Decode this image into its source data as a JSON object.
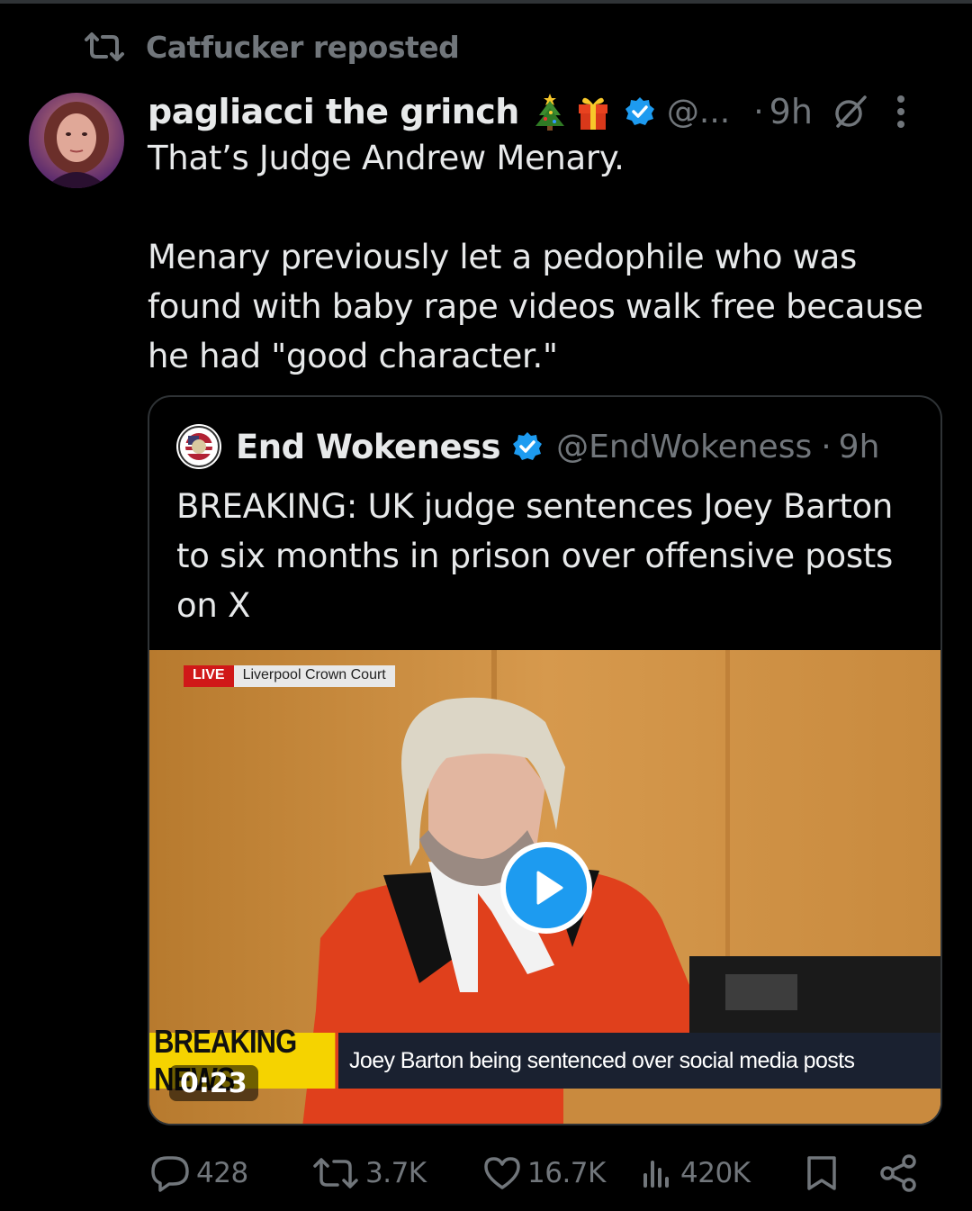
{
  "repost": {
    "label": "Catfucker reposted"
  },
  "post": {
    "display_name": "pagliacci the grinch",
    "emojis": [
      "christmas-tree-emoji",
      "gift-emoji"
    ],
    "handle": "@...",
    "separator": "·",
    "time": "9h",
    "text": "That’s Judge Andrew Menary.\n\nMenary previously let a pedophile who was found with baby rape videos walk free because he had \"good character.\""
  },
  "quote": {
    "display_name": "End Wokeness",
    "handle": "@EndWokeness",
    "separator": "·",
    "time": "9h",
    "text": "BREAKING: UK judge sentences Joey Barton to six months in prison over offensive posts on X",
    "video": {
      "live_label": "LIVE",
      "location": "Liverpool Crown Court",
      "ticker_label": "BREAKING NEWS",
      "ticker_headline": "Joey Barton being sentenced over social media posts",
      "duration": "0:23"
    }
  },
  "actions": {
    "replies": "428",
    "reposts": "3.7K",
    "likes": "16.7K",
    "views": "420K"
  },
  "colors": {
    "background": "#000000",
    "text": "#e7e9ea",
    "muted": "#71767b",
    "accent": "#1d9bf0",
    "border": "#2f3336"
  }
}
